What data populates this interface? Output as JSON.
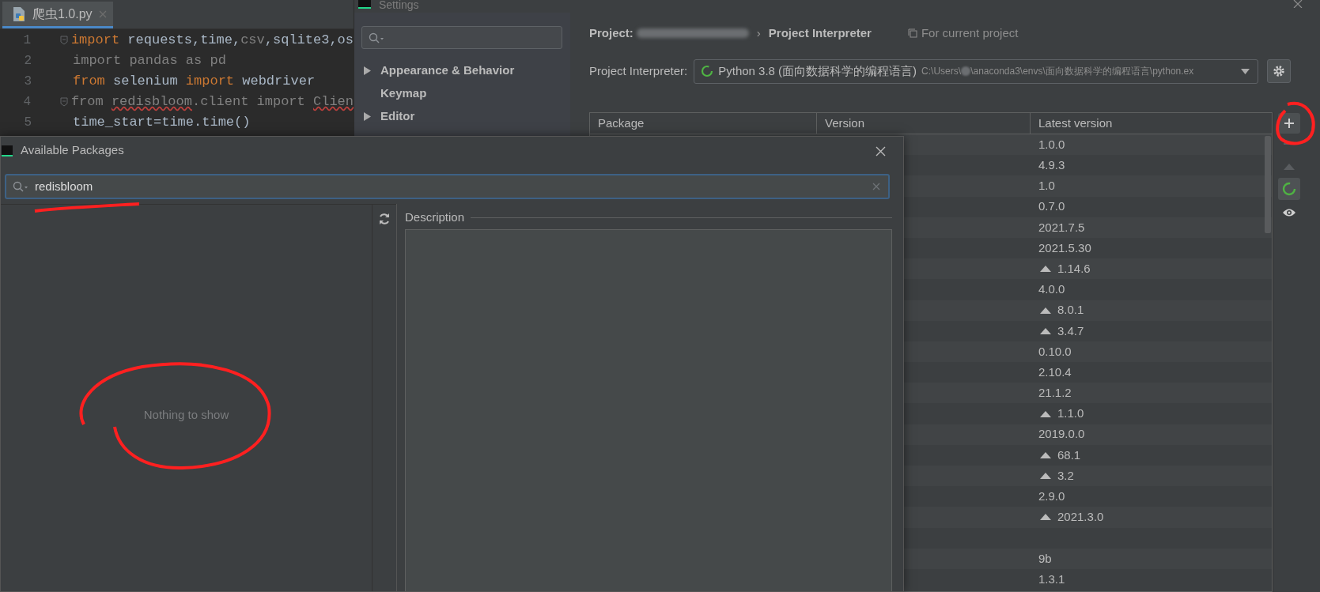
{
  "editor": {
    "tab": {
      "title": "爬虫1.0.py"
    },
    "lines": [
      {
        "number": "1",
        "fold": true,
        "tokens": [
          {
            "kind": "keyword",
            "text": "import"
          },
          {
            "kind": "plain",
            "text": " requests,time,"
          },
          {
            "kind": "dim",
            "text": "csv"
          },
          {
            "kind": "plain",
            "text": ",sqlite3,os"
          }
        ]
      },
      {
        "number": "2",
        "fold": false,
        "tokens": [
          {
            "kind": "dim",
            "text": "import pandas as pd"
          }
        ]
      },
      {
        "number": "3",
        "fold": false,
        "tokens": [
          {
            "kind": "keyword",
            "text": "from"
          },
          {
            "kind": "plain",
            "text": " selenium "
          },
          {
            "kind": "keyword",
            "text": "import"
          },
          {
            "kind": "plain",
            "text": " webdriver"
          }
        ]
      },
      {
        "number": "4",
        "fold": true,
        "tokens": [
          {
            "kind": "dim",
            "text": "from "
          },
          {
            "kind": "unresolved",
            "text": "redisbloom"
          },
          {
            "kind": "dim",
            "text": ".client import "
          },
          {
            "kind": "unresolved",
            "text": "Clien"
          }
        ]
      },
      {
        "number": "5",
        "fold": false,
        "tokens": [
          {
            "kind": "plain",
            "text": "time_start=time.time()"
          }
        ]
      }
    ]
  },
  "settings": {
    "title": "Settings",
    "sidebar": {
      "items": [
        {
          "label": "Appearance & Behavior",
          "expandable": true
        },
        {
          "label": "Keymap",
          "expandable": false
        },
        {
          "label": "Editor",
          "expandable": true
        }
      ]
    },
    "breadcrumb": {
      "project_label": "Project:",
      "separator": "›",
      "page": "Project Interpreter",
      "scope": "For current project"
    },
    "interpreter": {
      "label": "Project Interpreter:",
      "name": "Python 3.8 (面向数据科学的编程语言)",
      "path_start": "C:\\Users\\",
      "path_end": "\\anaconda3\\envs\\面向数据科学的编程语言\\python.ex"
    },
    "table": {
      "columns": [
        "Package",
        "Version",
        "Latest version"
      ],
      "rows": [
        {
          "latest_version": "1.0.0",
          "upgrade": false
        },
        {
          "latest_version": "4.9.3",
          "upgrade": false
        },
        {
          "latest_version": "1.0",
          "upgrade": false
        },
        {
          "latest_version": "0.7.0",
          "upgrade": false
        },
        {
          "latest_version": "2021.7.5",
          "upgrade": false
        },
        {
          "latest_version": "2021.5.30",
          "upgrade": false
        },
        {
          "latest_version": "1.14.6",
          "upgrade": true
        },
        {
          "latest_version": "4.0.0",
          "upgrade": false
        },
        {
          "latest_version": "8.0.1",
          "upgrade": true
        },
        {
          "latest_version": "3.4.7",
          "upgrade": true
        },
        {
          "latest_version": "0.10.0",
          "upgrade": false
        },
        {
          "latest_version": "2.10.4",
          "upgrade": false
        },
        {
          "latest_version": "21.1.2",
          "upgrade": false
        },
        {
          "latest_version": "1.1.0",
          "upgrade": true
        },
        {
          "latest_version": "2019.0.0",
          "upgrade": false
        },
        {
          "latest_version": "68.1",
          "upgrade": true
        },
        {
          "latest_version": "3.2",
          "upgrade": true
        },
        {
          "latest_version": "2.9.0",
          "upgrade": false
        },
        {
          "latest_version": "2021.3.0",
          "upgrade": true
        },
        {
          "upgrade": false
        },
        {
          "latest_version": "9b",
          "upgrade": false
        },
        {
          "latest_version": "1.3.1",
          "upgrade": false
        }
      ]
    }
  },
  "available_packages": {
    "title": "Available Packages",
    "search": {
      "value": "redisbloom"
    },
    "list": {
      "empty_text": "Nothing to show"
    },
    "description": {
      "title": "Description"
    }
  }
}
